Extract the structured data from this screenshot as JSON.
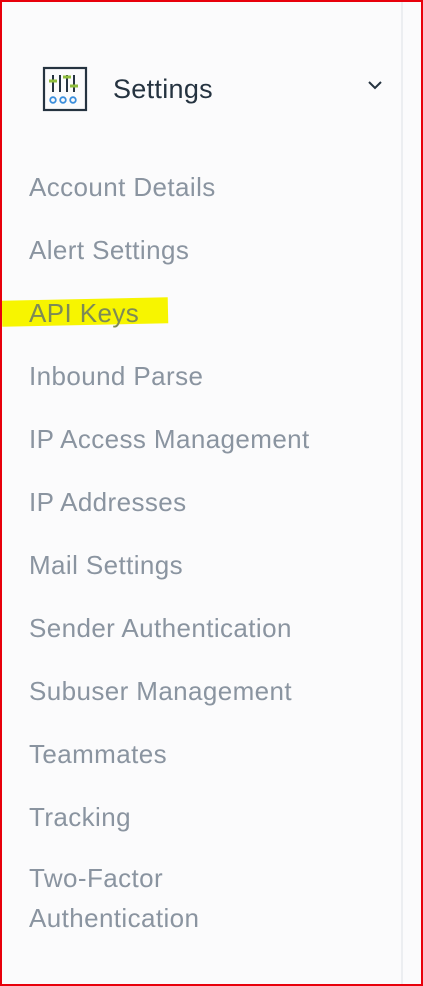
{
  "settings": {
    "title": "Settings",
    "icon": "settings-sliders-icon",
    "expanded": true,
    "chevron_icon": "chevron-down-icon"
  },
  "nav": {
    "items": [
      {
        "label": "Account Details"
      },
      {
        "label": "Alert Settings"
      },
      {
        "label": "API Keys",
        "highlighted": true
      },
      {
        "label": "Inbound Parse"
      },
      {
        "label": "IP Access Management"
      },
      {
        "label": "IP Addresses"
      },
      {
        "label": "Mail Settings"
      },
      {
        "label": "Sender Authentication"
      },
      {
        "label": "Subuser Management"
      },
      {
        "label": "Teammates"
      },
      {
        "label": "Tracking"
      },
      {
        "label": "Two-Factor Authentication"
      }
    ]
  },
  "colors": {
    "border": "#e8000b",
    "highlight": "#f7f500",
    "nav_text": "#8a94a0",
    "title_text": "#253340",
    "icon_green": "#8fbd3c",
    "icon_blue": "#3a8ddb"
  }
}
